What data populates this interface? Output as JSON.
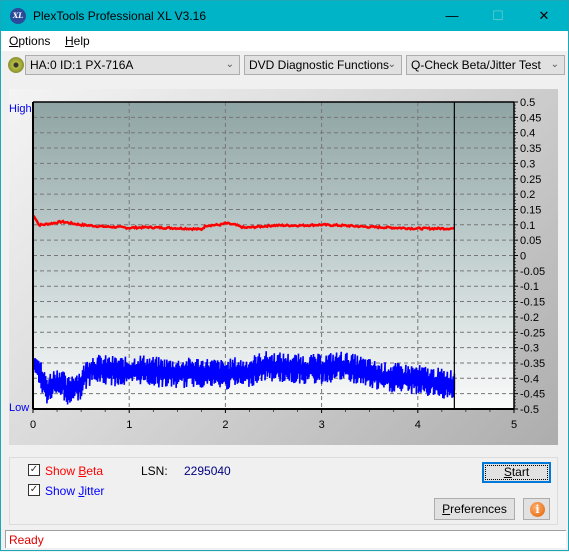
{
  "window": {
    "title": "PlexTools Professional XL V3.16",
    "logo_text": "XL",
    "controls": {
      "minimize": "—",
      "maximize": "☐",
      "close": "✕"
    }
  },
  "menu": [
    {
      "label": "Options",
      "mnemonic": "O",
      "rest": "ptions"
    },
    {
      "label": "Help",
      "mnemonic": "H",
      "rest": "elp"
    }
  ],
  "toolbar": {
    "drive_icon": "disc-icon",
    "drive": "HA:0 ID:1  PX-716A",
    "function": "DVD Diagnostic Functions",
    "test": "Q-Check Beta/Jitter Test"
  },
  "chart_data": {
    "type": "line",
    "title": "",
    "xlabel": "",
    "ylabel_left_high": "High",
    "ylabel_left_low": "Low",
    "xlim": [
      0,
      5
    ],
    "ylim": [
      -0.5,
      0.5
    ],
    "x_ticks": [
      "0",
      "1",
      "2",
      "3",
      "4",
      "5"
    ],
    "y_ticks": [
      "0.5",
      "0.45",
      "0.4",
      "0.35",
      "0.3",
      "0.25",
      "0.2",
      "0.15",
      "0.1",
      "0.05",
      "0",
      "-0.05",
      "-0.1",
      "-0.15",
      "-0.2",
      "-0.25",
      "-0.3",
      "-0.35",
      "-0.4",
      "-0.45",
      "-0.5"
    ],
    "grid": true,
    "end_marker_x": 4.38,
    "series": [
      {
        "name": "Beta",
        "color": "#ff0000",
        "x": [
          0,
          0.03,
          0.06,
          0.1,
          0.2,
          0.3,
          0.5,
          0.7,
          0.9,
          1.0,
          1.2,
          1.4,
          1.6,
          1.75,
          1.8,
          1.95,
          2.0,
          2.1,
          2.2,
          2.5,
          2.8,
          3.0,
          3.2,
          3.5,
          3.8,
          4.0,
          4.2,
          4.38
        ],
        "values": [
          0.13,
          0.12,
          0.1,
          0.1,
          0.105,
          0.11,
          0.1,
          0.095,
          0.092,
          0.09,
          0.092,
          0.09,
          0.088,
          0.085,
          0.098,
          0.1,
          0.105,
          0.1,
          0.09,
          0.098,
          0.098,
          0.1,
          0.098,
          0.093,
          0.09,
          0.088,
          0.088,
          0.088
        ]
      },
      {
        "name": "Jitter",
        "color": "#0000ff",
        "x": [
          0,
          0.05,
          0.1,
          0.15,
          0.2,
          0.3,
          0.35,
          0.4,
          0.5,
          0.55,
          0.6,
          0.8,
          1.0,
          1.1,
          1.3,
          1.5,
          1.7,
          1.9,
          2.0,
          2.1,
          2.2,
          2.4,
          2.6,
          2.8,
          3.0,
          3.2,
          3.4,
          3.6,
          3.8,
          4.0,
          4.2,
          4.38
        ],
        "values": [
          -0.35,
          -0.36,
          -0.41,
          -0.44,
          -0.42,
          -0.41,
          -0.45,
          -0.43,
          -0.42,
          -0.39,
          -0.37,
          -0.375,
          -0.38,
          -0.37,
          -0.38,
          -0.385,
          -0.38,
          -0.385,
          -0.39,
          -0.38,
          -0.385,
          -0.36,
          -0.365,
          -0.37,
          -0.37,
          -0.36,
          -0.375,
          -0.395,
          -0.4,
          -0.405,
          -0.415,
          -0.42
        ]
      }
    ]
  },
  "controls": {
    "show_beta": {
      "label": "Show Beta",
      "prefix": "Show ",
      "mnemonic": "B",
      "rest": "eta",
      "checked": true,
      "color": "#ff0000"
    },
    "show_jitter": {
      "label": "Show Jitter",
      "prefix": "Show ",
      "mnemonic": "J",
      "rest": "itter",
      "checked": true,
      "color": "#0000ff"
    },
    "lsn_label": "LSN:",
    "lsn_value": "2295040",
    "start_button": {
      "mnemonic": "S",
      "rest": "tart"
    },
    "preferences_button": {
      "mnemonic": "P",
      "rest": "references"
    },
    "info_icon": "info-icon"
  },
  "status": "Ready"
}
